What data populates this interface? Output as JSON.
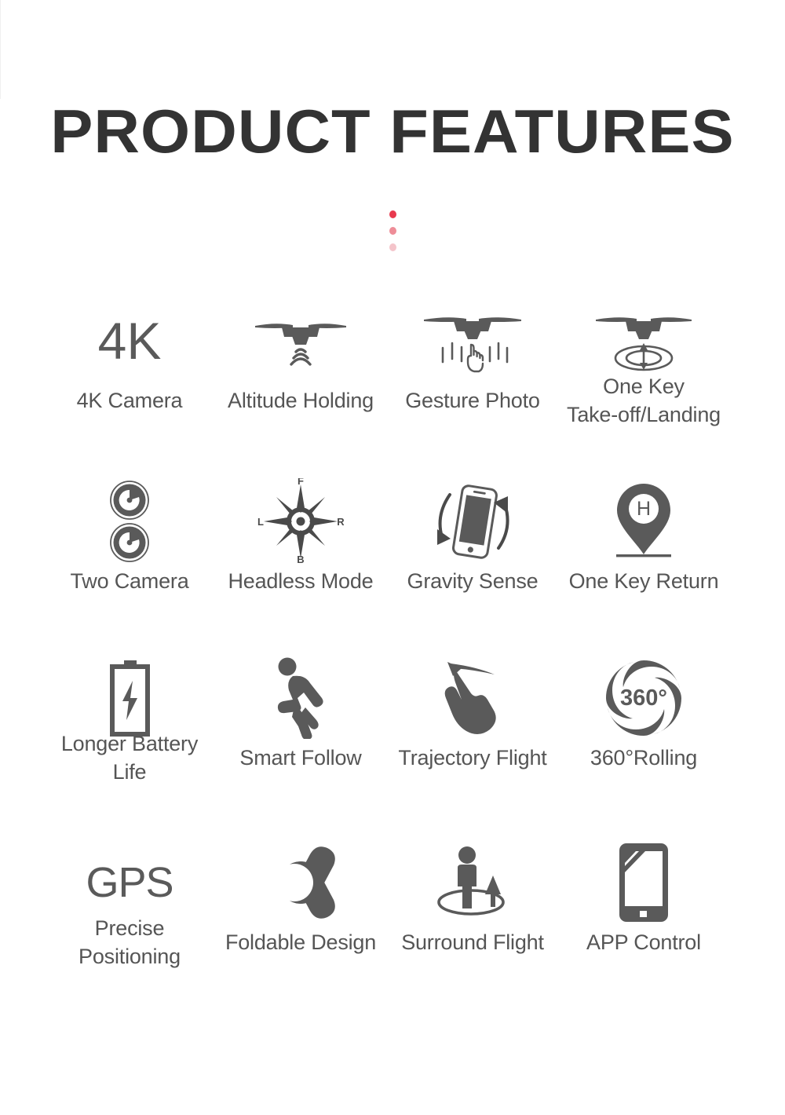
{
  "header": {
    "title": "PRODUCT FEATURES",
    "dots": [
      {
        "name": "dot-1",
        "color": "#E8394E"
      },
      {
        "name": "dot-2",
        "color": "#EE8D98"
      },
      {
        "name": "dot-3",
        "color": "#F4C4CA"
      }
    ]
  },
  "colors": {
    "title": "#333333",
    "label": "#555555",
    "icon": "#5a5a5a",
    "background": "#ffffff",
    "accent": "#E8394E"
  },
  "features": [
    {
      "id": "4k-camera",
      "icon": "4k-text-icon",
      "icon_text": "4K",
      "label": "4K Camera",
      "lines": [
        "4K Camera"
      ]
    },
    {
      "id": "altitude-holding",
      "icon": "drone-signal-icon",
      "label": "Altitude Holding",
      "lines": [
        "Altitude Holding"
      ]
    },
    {
      "id": "gesture-photo",
      "icon": "drone-hand-gesture-icon",
      "label": "Gesture Photo",
      "lines": [
        "Gesture Photo"
      ]
    },
    {
      "id": "one-key-takeoff-landing",
      "icon": "drone-takeoff-landing-icon",
      "label": "One Key Take-off/Landing",
      "lines": [
        "One Key",
        "Take-off/Landing"
      ]
    },
    {
      "id": "two-camera",
      "icon": "dual-lens-icon",
      "label": "Two Camera",
      "lines": [
        "Two Camera"
      ]
    },
    {
      "id": "headless-mode",
      "icon": "compass-rose-icon",
      "label": "Headless Mode",
      "lines": [
        "Headless Mode"
      ],
      "compass": {
        "front": "F",
        "left": "L",
        "right": "R",
        "back": "B"
      }
    },
    {
      "id": "gravity-sense",
      "icon": "phone-tilt-rotation-icon",
      "label": "Gravity Sense",
      "lines": [
        "Gravity Sense"
      ]
    },
    {
      "id": "one-key-return",
      "icon": "home-map-pin-icon",
      "icon_text": "H",
      "label": "One Key Return",
      "lines": [
        "One Key Return"
      ]
    },
    {
      "id": "longer-battery-life",
      "icon": "battery-bolt-icon",
      "label": "Longer Battery Life",
      "lines": [
        "Longer Battery",
        "Life"
      ]
    },
    {
      "id": "smart-follow",
      "icon": "running-person-icon",
      "label": "Smart Follow",
      "lines": [
        "Smart Follow"
      ]
    },
    {
      "id": "trajectory-flight",
      "icon": "hand-draw-path-icon",
      "label": "Trajectory Flight",
      "lines": [
        "Trajectory Flight"
      ]
    },
    {
      "id": "360-rolling",
      "icon": "360-swirl-icon",
      "icon_text": "360°",
      "label": "360°Rolling",
      "lines": [
        "360°Rolling"
      ]
    },
    {
      "id": "precise-positioning",
      "icon": "gps-text-icon",
      "icon_text": "GPS",
      "label": "Precise Positioning",
      "lines": [
        "Precise",
        "Positioning"
      ]
    },
    {
      "id": "foldable-design",
      "icon": "foldable-propeller-icon",
      "label": "Foldable Design",
      "lines": [
        "Foldable Design"
      ]
    },
    {
      "id": "surround-flight",
      "icon": "person-orbit-icon",
      "label": "Surround Flight",
      "lines": [
        "Surround Flight"
      ]
    },
    {
      "id": "app-control",
      "icon": "smartphone-icon",
      "label": "APP Control",
      "lines": [
        "APP Control"
      ]
    }
  ]
}
